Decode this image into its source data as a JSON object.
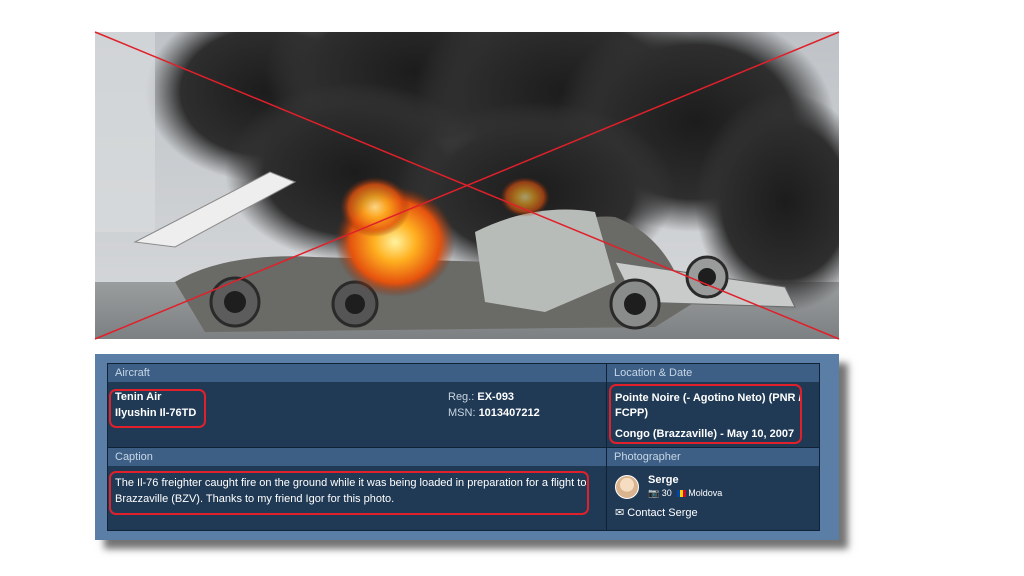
{
  "photo": {
    "alt": "Burning Ilyushin Il-76 on the ground"
  },
  "aircraft": {
    "header": "Aircraft",
    "airline": "Tenin Air",
    "type": "Ilyushin Il-76TD",
    "reg_label": "Reg.:",
    "reg_value": "EX-093",
    "msn_label": "MSN:",
    "msn_value": "1013407212"
  },
  "location": {
    "header": "Location & Date",
    "airport": "Pointe Noire (- Agotino Neto) (PNR / FCPP)",
    "country_date": "Congo (Brazzaville) - May 10, 2007"
  },
  "caption": {
    "header": "Caption",
    "text": "The Il-76 freighter caught fire on the ground while it was being loaded in preparation for a flight to Brazzaville (BZV). Thanks to my friend Igor for this photo."
  },
  "photographer": {
    "header": "Photographer",
    "name": "Serge",
    "photo_count": "30",
    "country": "Moldova",
    "contact_label": "Contact Serge",
    "flag_colors": [
      "#0046ae",
      "#ffd200",
      "#cc092f"
    ]
  },
  "colors": {
    "annotation_red": "#e0202a",
    "panel_bg": "#203a55",
    "header_bg": "#3d5f86"
  }
}
